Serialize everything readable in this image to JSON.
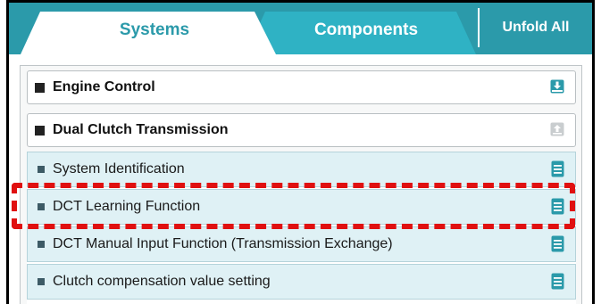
{
  "tabs": {
    "systems_label": "Systems",
    "components_label": "Components",
    "unfold_all_label": "Unfold All"
  },
  "sections": [
    {
      "label": "Engine Control",
      "icon": "download-icon"
    },
    {
      "label": "Dual Clutch Transmission",
      "icon": "upload-icon"
    }
  ],
  "items": [
    {
      "label": "System Identification",
      "icon": "document-icon"
    },
    {
      "label": "DCT Learning Function",
      "icon": "document-icon"
    },
    {
      "label": "DCT Manual Input Function (Transmission Exchange)",
      "icon": "document-icon"
    },
    {
      "label": "Clutch compensation value setting",
      "icon": "document-icon"
    }
  ],
  "colors": {
    "accent": "#2b9aaa",
    "item_bg": "#dff1f5",
    "highlight": "#e01010"
  }
}
